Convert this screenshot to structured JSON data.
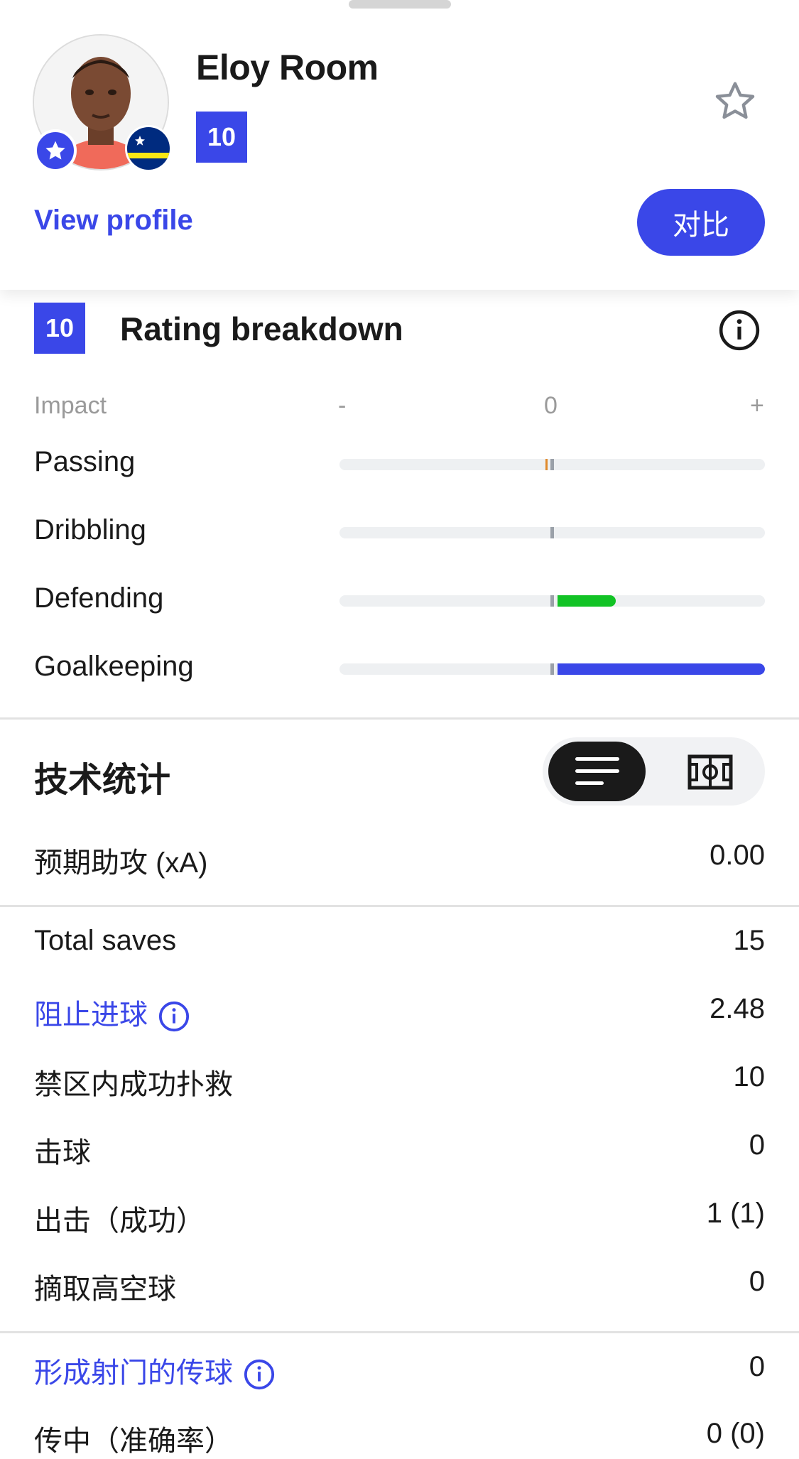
{
  "player": {
    "name": "Eloy Room",
    "rating": "10",
    "view_profile_label": "View profile",
    "compare_label": "对比"
  },
  "rating_breakdown": {
    "rating": "10",
    "title": "Rating breakdown",
    "impact_label": "Impact",
    "scale_minus": "-",
    "scale_zero": "0",
    "scale_plus": "+",
    "rows": [
      {
        "label": "Passing",
        "impact": -0.01
      },
      {
        "label": "Dribbling",
        "impact": 0.0
      },
      {
        "label": "Defending",
        "impact": 0.28
      },
      {
        "label": "Goalkeeping",
        "impact": 1.0
      }
    ]
  },
  "tech_stats": {
    "title": "技术统计",
    "rows": [
      {
        "label": "预期助攻 (xA)",
        "value": "0.00"
      }
    ]
  },
  "goalkeeping_stats": {
    "rows": [
      {
        "label": "Total saves",
        "value": "15"
      },
      {
        "label": "阻止进球",
        "value": "2.48"
      },
      {
        "label": "禁区内成功扑救",
        "value": "10"
      },
      {
        "label": "击球",
        "value": "0"
      },
      {
        "label": "出击（成功）",
        "value": "1 (1)"
      },
      {
        "label": "摘取高空球",
        "value": "0"
      }
    ]
  },
  "passing_stats": {
    "rows": [
      {
        "label": "形成射门的传球",
        "value": "0"
      },
      {
        "label": "传中（准确率）",
        "value": "0 (0)"
      }
    ]
  },
  "colors": {
    "accent": "#3a47e8",
    "positive": "#12c325",
    "negative": "#e08a2c",
    "track": "#eef0f2"
  },
  "icons": {
    "favorite": "star-outline-icon",
    "info": "info-circle-icon",
    "list_view": "list-icon",
    "pitch_view": "pitch-icon"
  }
}
